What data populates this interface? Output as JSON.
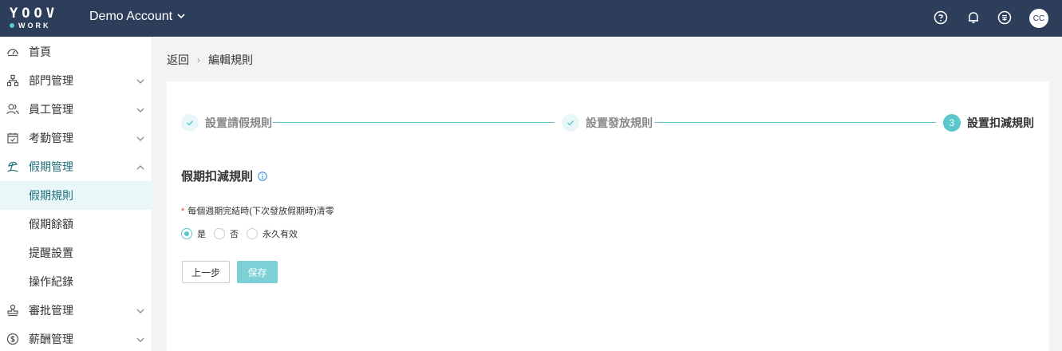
{
  "header": {
    "logo_top": "YOOV",
    "logo_bottom": "WORK",
    "account_label": "Demo Account",
    "avatar_initials": "CC",
    "icons": [
      "help-icon",
      "bell-icon",
      "calculator-icon"
    ]
  },
  "sidebar": {
    "items": [
      {
        "label": "首頁",
        "icon": "dashboard-icon"
      },
      {
        "label": "部門管理",
        "icon": "org-chart-icon"
      },
      {
        "label": "員工管理",
        "icon": "users-icon"
      },
      {
        "label": "考勤管理",
        "icon": "calendar-check-icon"
      },
      {
        "label": "假期管理",
        "icon": "beach-icon"
      },
      {
        "label": "假期規則"
      },
      {
        "label": "假期餘額"
      },
      {
        "label": "提醒設置"
      },
      {
        "label": "操作紀錄"
      },
      {
        "label": "審批管理",
        "icon": "stamp-icon"
      },
      {
        "label": "薪酬管理",
        "icon": "dollar-icon"
      }
    ]
  },
  "breadcrumb": {
    "back": "返回",
    "sep": "›",
    "current": "編輯規則"
  },
  "steps": [
    {
      "title": "設置請假規則",
      "status": "done"
    },
    {
      "title": "設置發放規則",
      "status": "done"
    },
    {
      "title": "設置扣減規則",
      "status": "current",
      "number": "3"
    }
  ],
  "form": {
    "section_title": "假期扣減規則",
    "required_mark": "*",
    "field_label": "每個週期完結時(下次發放假期時)清零",
    "options": [
      "是",
      "否",
      "永久有效"
    ],
    "selected": "是"
  },
  "buttons": {
    "prev": "上一步",
    "save": "保存"
  },
  "colors": {
    "header_bg": "#2c3e5a",
    "accent": "#5bc6cc",
    "active_text": "#1f6f7a",
    "required": "#e0423d"
  }
}
